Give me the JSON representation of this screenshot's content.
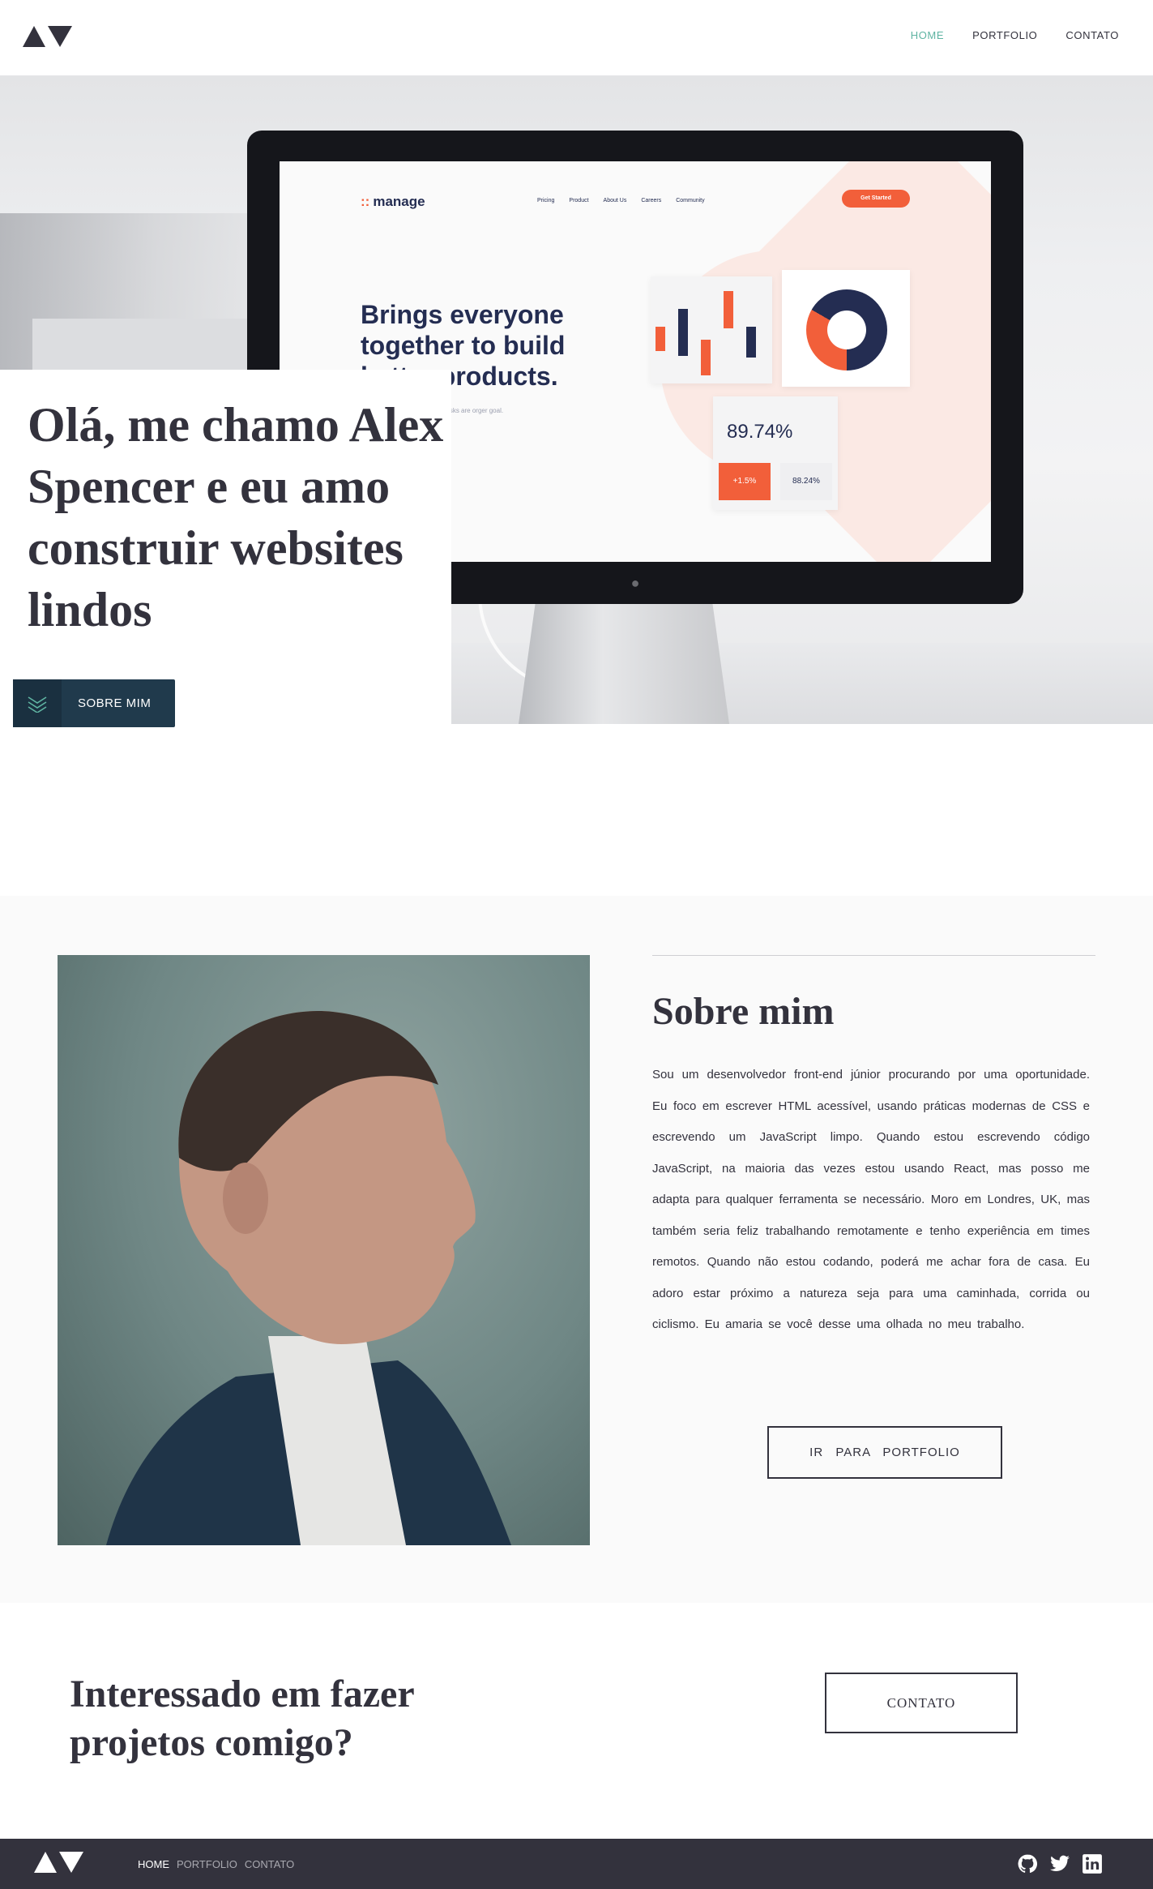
{
  "header": {
    "nav": [
      {
        "label": "HOME",
        "active": true
      },
      {
        "label": "PORTFOLIO",
        "active": false
      },
      {
        "label": "CONTATO",
        "active": false
      }
    ]
  },
  "hero": {
    "title": "Olá, me chamo Alex Spencer e eu amo construir websites lindos",
    "button_label": "SOBRE MIM",
    "mock_app": {
      "brand": "manage",
      "nav": [
        "Pricing",
        "Product",
        "About Us",
        "Careers",
        "Community"
      ],
      "cta": "Get Started",
      "headline": "Brings everyone together to build better products.",
      "subtext": "mple for software r everyday tasks are orger goal.",
      "stat_big": "89.74%",
      "stat_chip_1": "+1.5%",
      "stat_chip_2": "88.24%"
    }
  },
  "about": {
    "title": "Sobre mim",
    "text": "Sou um desenvolvedor front-end júnior procurando por uma oportunidade. Eu foco em escrever HTML acessível, usando práticas modernas de CSS e escrevendo um JavaScript limpo. Quando estou escrevendo código JavaScript, na maioria das vezes estou usando React, mas posso me adapta para qualquer ferramenta se necessário. Moro em Londres, UK, mas também seria feliz trabalhando remotamente e tenho experiência em times remotos. Quando não estou codando, poderá me achar fora de casa. Eu adoro estar próximo a natureza seja para uma caminhada, corrida ou ciclismo. Eu amaria se você desse uma olhada no meu trabalho.",
    "button_label": "IR PARA PORTFOLIO"
  },
  "cta": {
    "title": "Interessado em fazer projetos comigo?",
    "button_label": "CONTATO"
  },
  "footer": {
    "nav": [
      {
        "label": "HOME",
        "active": true
      },
      {
        "label": "PORTFOLIO",
        "active": false
      },
      {
        "label": "CONTATO",
        "active": false
      }
    ],
    "social": [
      "github-icon",
      "twitter-icon",
      "linkedin-icon"
    ]
  },
  "colors": {
    "accent": "#5fb4a2",
    "dark": "#33323d",
    "button_dark": "#203a4c",
    "mock_orange": "#f25f3a",
    "mock_navy": "#242d52"
  }
}
